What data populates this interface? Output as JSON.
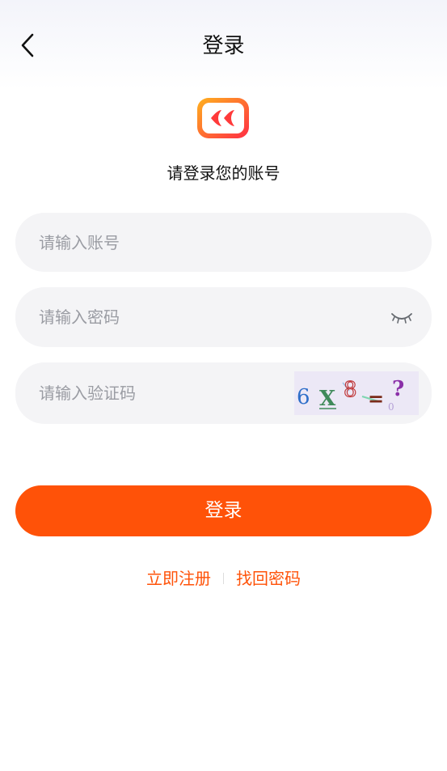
{
  "header": {
    "title": "登录",
    "back_icon": "chevron-left-icon"
  },
  "logo": {
    "icon": "double-heart-logo-icon",
    "colors": [
      "#ffb21e",
      "#ff2c44"
    ]
  },
  "subtitle": "请登录您的账号",
  "form": {
    "account": {
      "placeholder": "请输入账号",
      "value": ""
    },
    "password": {
      "placeholder": "请输入密码",
      "value": "",
      "toggle_icon": "eye-closed-icon"
    },
    "captcha": {
      "placeholder": "请输入验证码",
      "value": "",
      "image_text": "6 X 8 = ?"
    }
  },
  "login_button": {
    "label": "登录"
  },
  "links": {
    "register": "立即注册",
    "forgot_password": "找回密码"
  },
  "colors": {
    "accent": "#ff5208",
    "field_bg": "#f4f4f6",
    "placeholder": "#9a9ca3"
  }
}
